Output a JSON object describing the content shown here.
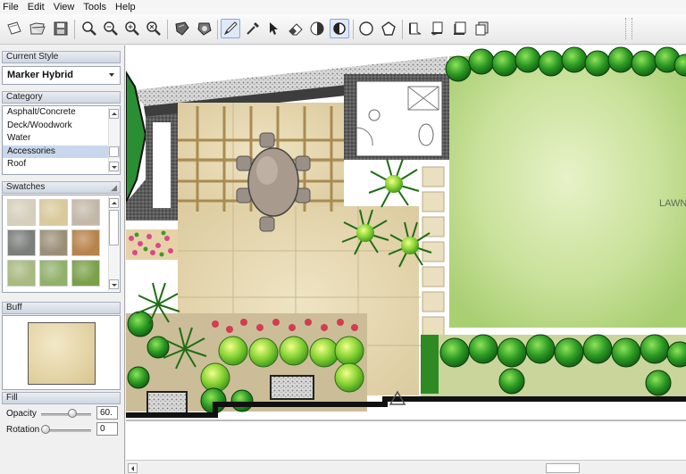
{
  "menu": [
    "File",
    "Edit",
    "View",
    "Tools",
    "Help"
  ],
  "toolbar": {
    "tools": [
      "new-document-icon",
      "open-folder-icon",
      "save-icon",
      "zoom-icon",
      "zoom-out-icon",
      "zoom-in-icon",
      "zoom-fit-icon",
      "stamp-icon",
      "stamp-alt-icon",
      "pen-icon",
      "eyedropper-icon",
      "pointer-icon",
      "eraser-icon",
      "shadow-icon",
      "contrast-icon",
      "circle-icon",
      "pentagon-icon",
      "layer-icon",
      "layer-alt-icon",
      "layer-stack-icon",
      "layer-shadow-icon"
    ]
  },
  "panel": {
    "current_style_header": "Current Style",
    "current_style_value": "Marker Hybrid",
    "category_header": "Category",
    "categories": [
      "Asphalt/Concrete",
      "Deck/Woodwork",
      "Water",
      "Accessories",
      "Roof"
    ],
    "selected_category": "Accessories",
    "swatches_header": "Swatches",
    "swatches": [
      "#d5cfbb",
      "#d9c99b",
      "#c3b8a8",
      "#7b7e7a",
      "#9b8f79",
      "#b7834b",
      "#a9b980",
      "#90b16a",
      "#7aa149"
    ],
    "selected_swatch_header": "Buff",
    "fill_header": "Fill",
    "opacity_label": "Opacity",
    "opacity_value": "60.",
    "opacity_level": 0.62,
    "rotation_label": "Rotation",
    "rotation_value": "0",
    "rotation_level": 0
  },
  "canvas": {
    "lawn_label": "LAWN"
  },
  "colors": {
    "accent": "#8aa8d6",
    "paving": "#e3d6b4",
    "lawn": "#b8d88a",
    "shrub": "#2f8a24"
  }
}
